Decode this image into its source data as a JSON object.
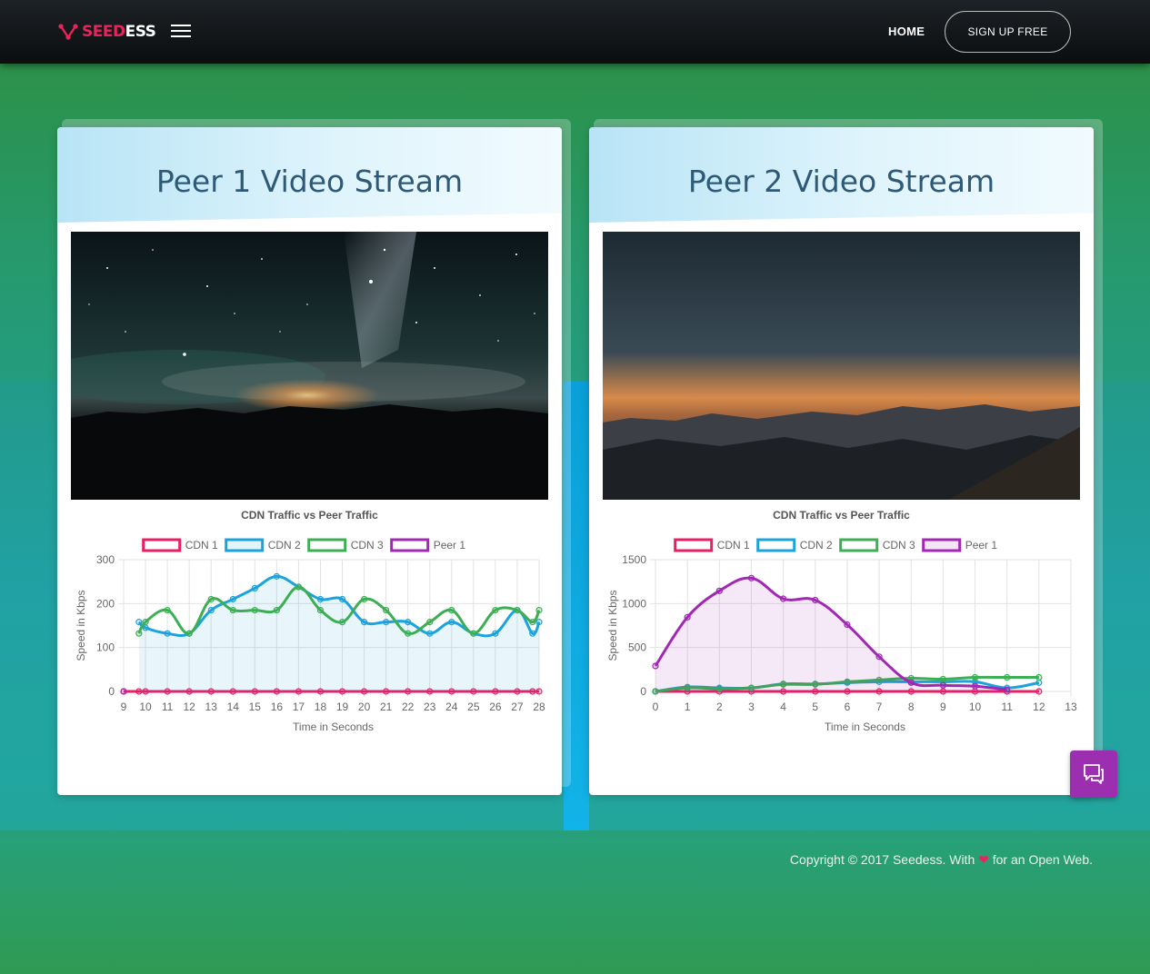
{
  "brand": {
    "part_a": "SEED",
    "part_b": "ESS",
    "accent": "#e8245c"
  },
  "nav": {
    "home": "HOME",
    "signup": "SIGN UP FREE"
  },
  "cards": [
    {
      "title": "Peer 1 Video Stream",
      "chart_title": "CDN Traffic vs Peer Traffic"
    },
    {
      "title": "Peer 2 Video Stream",
      "chart_title": "CDN Traffic vs Peer Traffic"
    }
  ],
  "footer": {
    "prefix": "Copyright © 2017 Seedess. With",
    "heart": "❤",
    "suffix": "for an Open Web."
  },
  "chart_data": [
    {
      "type": "line",
      "title": "CDN Traffic vs Peer Traffic",
      "xlabel": "Time in Seconds",
      "ylabel": "Speed in Kbps",
      "x": [
        9,
        9.7,
        10,
        11,
        12,
        13,
        14,
        15,
        16,
        17,
        18,
        19,
        20,
        21,
        22,
        23,
        24,
        25,
        26,
        27,
        27.7,
        28
      ],
      "xticks": [
        9,
        10,
        11,
        12,
        13,
        14,
        15,
        16,
        17,
        18,
        19,
        20,
        21,
        22,
        23,
        24,
        25,
        26,
        27,
        28
      ],
      "ylim": [
        0,
        300
      ],
      "yticks": [
        0,
        100,
        200,
        300
      ],
      "legend_position": "top",
      "series": [
        {
          "name": "CDN 1",
          "color": "#e91e63",
          "fill": false,
          "values": [
            0,
            0,
            0,
            0,
            0,
            0,
            0,
            0,
            0,
            0,
            0,
            0,
            0,
            0,
            0,
            0,
            0,
            0,
            0,
            0,
            0,
            0
          ]
        },
        {
          "name": "CDN 2",
          "color": "#1aa3dc",
          "fill": true,
          "values": [
            null,
            158,
            145,
            132,
            132,
            185,
            210,
            235,
            262,
            238,
            210,
            210,
            158,
            158,
            158,
            132,
            158,
            132,
            132,
            185,
            132,
            158
          ]
        },
        {
          "name": "CDN 3",
          "color": "#3cae54",
          "fill": false,
          "values": [
            null,
            132,
            158,
            185,
            132,
            210,
            185,
            185,
            185,
            238,
            185,
            158,
            210,
            185,
            132,
            158,
            185,
            132,
            185,
            185,
            158,
            185
          ]
        },
        {
          "name": "Peer 1",
          "color": "#a127b4",
          "fill": false,
          "values": [
            0,
            null,
            null,
            null,
            null,
            null,
            null,
            null,
            null,
            null,
            null,
            null,
            null,
            null,
            null,
            null,
            null,
            null,
            null,
            null,
            null,
            null
          ]
        }
      ]
    },
    {
      "type": "line",
      "title": "CDN Traffic vs Peer Traffic",
      "xlabel": "Time in Seconds",
      "ylabel": "Speed in Kbps",
      "x": [
        0,
        1,
        2,
        3,
        4,
        5,
        6,
        7,
        8,
        9,
        10,
        11,
        12
      ],
      "xticks": [
        0,
        1,
        2,
        3,
        4,
        5,
        6,
        7,
        8,
        9,
        10,
        11,
        12,
        13
      ],
      "ylim": [
        0,
        1500
      ],
      "yticks": [
        0,
        500,
        1000,
        1500
      ],
      "legend_position": "top",
      "series": [
        {
          "name": "CDN 1",
          "color": "#e91e63",
          "fill": false,
          "values": [
            0,
            0,
            0,
            0,
            0,
            0,
            0,
            0,
            0,
            0,
            0,
            0,
            0
          ]
        },
        {
          "name": "CDN 2",
          "color": "#1aa3dc",
          "fill": false,
          "values": [
            0,
            50,
            40,
            40,
            85,
            85,
            100,
            110,
            110,
            110,
            110,
            40,
            100
          ]
        },
        {
          "name": "CDN 3",
          "color": "#3cae54",
          "fill": false,
          "values": [
            0,
            40,
            30,
            40,
            80,
            80,
            110,
            130,
            150,
            140,
            160,
            160,
            160
          ]
        },
        {
          "name": "Peer 1",
          "color": "#a127b4",
          "fill": true,
          "values": [
            290,
            845,
            1145,
            1290,
            1055,
            1040,
            760,
            395,
            100,
            70,
            60,
            20,
            null
          ]
        }
      ]
    }
  ]
}
